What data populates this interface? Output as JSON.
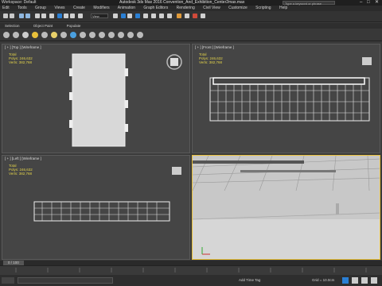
{
  "titlebar": {
    "workspace": "Workspace: Default",
    "app_title": "Autodesk 3ds Max 2016    Convention_And_Exhibition_Center2max.max",
    "search_placeholder": "Type a keyword or phrase",
    "min": "–",
    "max": "□",
    "close": "✕"
  },
  "menu": [
    "Edit",
    "Tools",
    "Group",
    "Views",
    "Create",
    "Modifiers",
    "Animation",
    "Graph Editors",
    "Rendering",
    "Civil View",
    "Customize",
    "Scripting",
    "Help"
  ],
  "toolbar": {
    "view_dropdown": "View"
  },
  "ribbon": {
    "tabs": [
      "Selection",
      "Object Paint",
      "Populate"
    ]
  },
  "viewports": {
    "top": {
      "label": "[ + ] [Top ] [Wireframe ]",
      "total": "Total",
      "polys": "Polys:   246,632",
      "verts": "Verts:   382,768"
    },
    "front": {
      "label": "[ + ] [Front ] [Wireframe ]",
      "total": "Total",
      "polys": "Polys:   246,632",
      "verts": "Verts:   382,768"
    },
    "left": {
      "label": "[ + ] [Left ] [Wireframe ]",
      "total": "Total",
      "polys": "Polys:   246,632",
      "verts": "Verts:   382,768"
    },
    "persp": {
      "label": ""
    }
  },
  "timeline": {
    "frame": "0 / 100"
  },
  "status": {
    "grid": "Grid = 10.0cm",
    "add_time_tag": "Add Time Tag"
  },
  "colors": {
    "accent_blue": "#2a7fd4",
    "stats_yellow": "#e2d24a"
  }
}
